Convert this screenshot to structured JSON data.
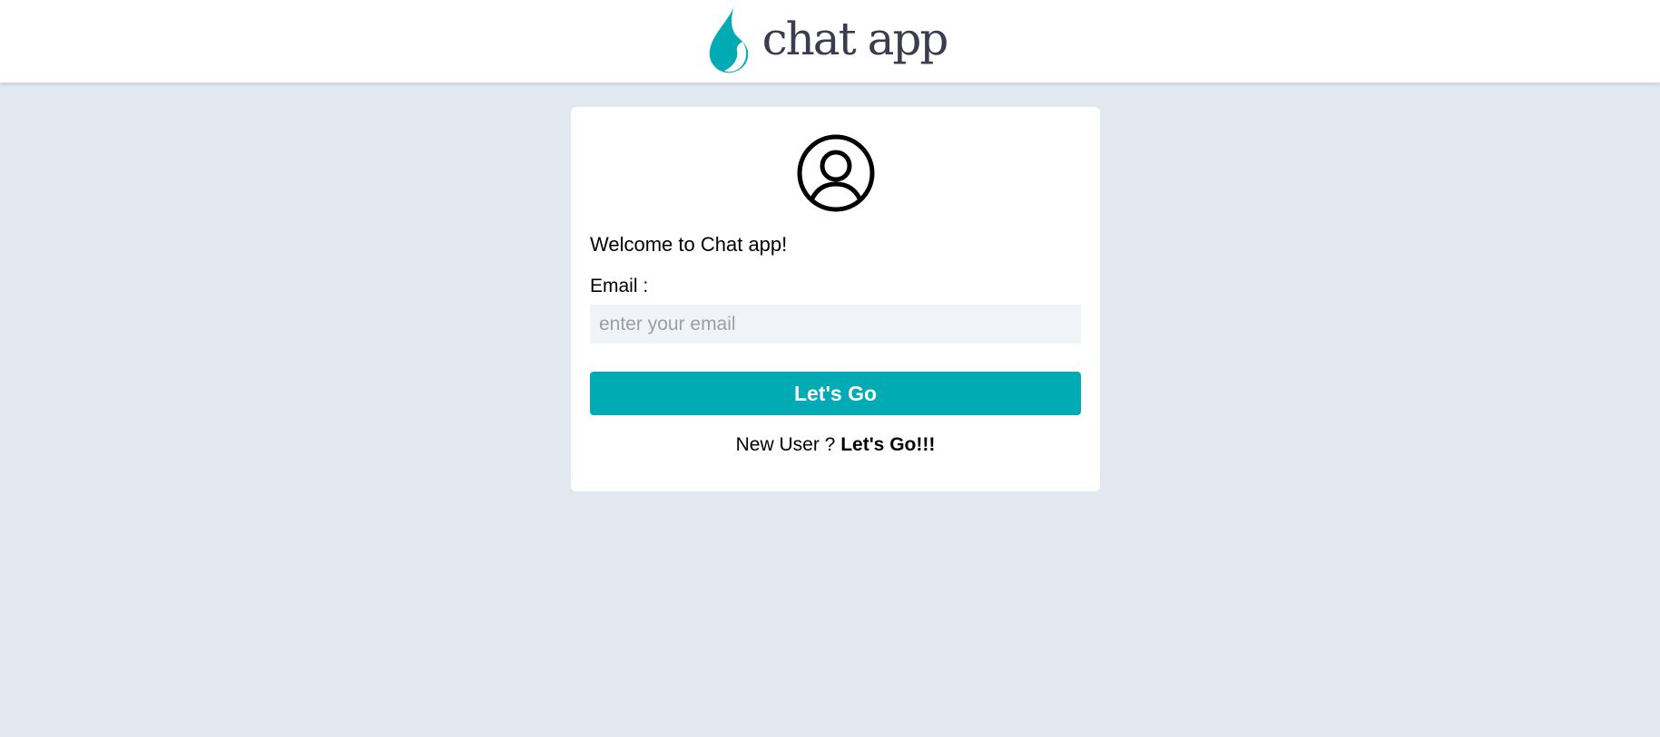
{
  "header": {
    "logo_text": "chat app",
    "logo_icon": "flame-drop-icon",
    "brand_color": "#00abb3"
  },
  "login_card": {
    "avatar_icon": "user-circle-icon",
    "welcome_text": "Welcome to Chat app!",
    "email_label": "Email :",
    "email_value": "",
    "email_placeholder": "enter your email",
    "submit_label": "Let's Go",
    "signup_prompt": "New User ?",
    "signup_link": "Let's Go!!!"
  },
  "colors": {
    "page_background": "#e2e8f0",
    "card_background": "#ffffff",
    "input_background": "#f0f3f8",
    "button_background": "#00abb3",
    "logo_text": "#3b3c4e"
  }
}
